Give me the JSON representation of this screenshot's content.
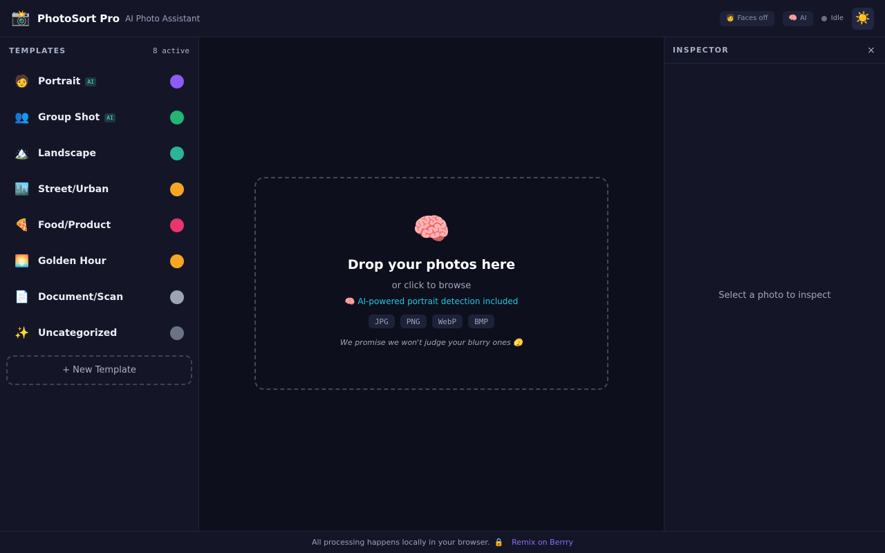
{
  "header": {
    "logo_icon": "📸",
    "title": "PhotoSort Pro",
    "subtitle": "AI Photo Assistant",
    "faces_toggle": {
      "icon": "🧑",
      "label": "Faces off"
    },
    "ai_toggle": {
      "icon": "🧠",
      "label": "AI"
    },
    "status_label": "Idle",
    "theme_icon": "☀️"
  },
  "sidebar": {
    "heading": "TEMPLATES",
    "count": "8 active",
    "items": [
      {
        "emoji": "🧑",
        "label": "Portrait",
        "ai": "AI",
        "color": "#8b5cf6"
      },
      {
        "emoji": "👥",
        "label": "Group Shot",
        "ai": "AI",
        "color": "#22b573"
      },
      {
        "emoji": "🏔️",
        "label": "Landscape",
        "color": "#2cb49a"
      },
      {
        "emoji": "🏙️",
        "label": "Street/Urban",
        "color": "#f5a623"
      },
      {
        "emoji": "🍕",
        "label": "Food/Product",
        "color": "#e8356d"
      },
      {
        "emoji": "🌅",
        "label": "Golden Hour",
        "color": "#f5a623"
      },
      {
        "emoji": "📄",
        "label": "Document/Scan",
        "color": "#9ca3b4"
      },
      {
        "emoji": "✨",
        "label": "Uncategorized",
        "color": "#6b7285"
      }
    ],
    "new_template_label": "+ New Template"
  },
  "dropzone": {
    "icon": "🧠",
    "title": "Drop your photos here",
    "subtitle": "or click to browse",
    "ai_note": "🧠 AI-powered portrait detection included",
    "formats": [
      "JPG",
      "PNG",
      "WebP",
      "BMP"
    ],
    "note": "We promise we won't judge your blurry ones 🫣"
  },
  "inspector": {
    "heading": "INSPECTOR",
    "close_icon": "×",
    "empty_text": "Select a photo to inspect"
  },
  "footer": {
    "text": "All processing happens locally in your browser.",
    "lock_icon": "🔒",
    "link_text": "Remix on Berrry"
  }
}
